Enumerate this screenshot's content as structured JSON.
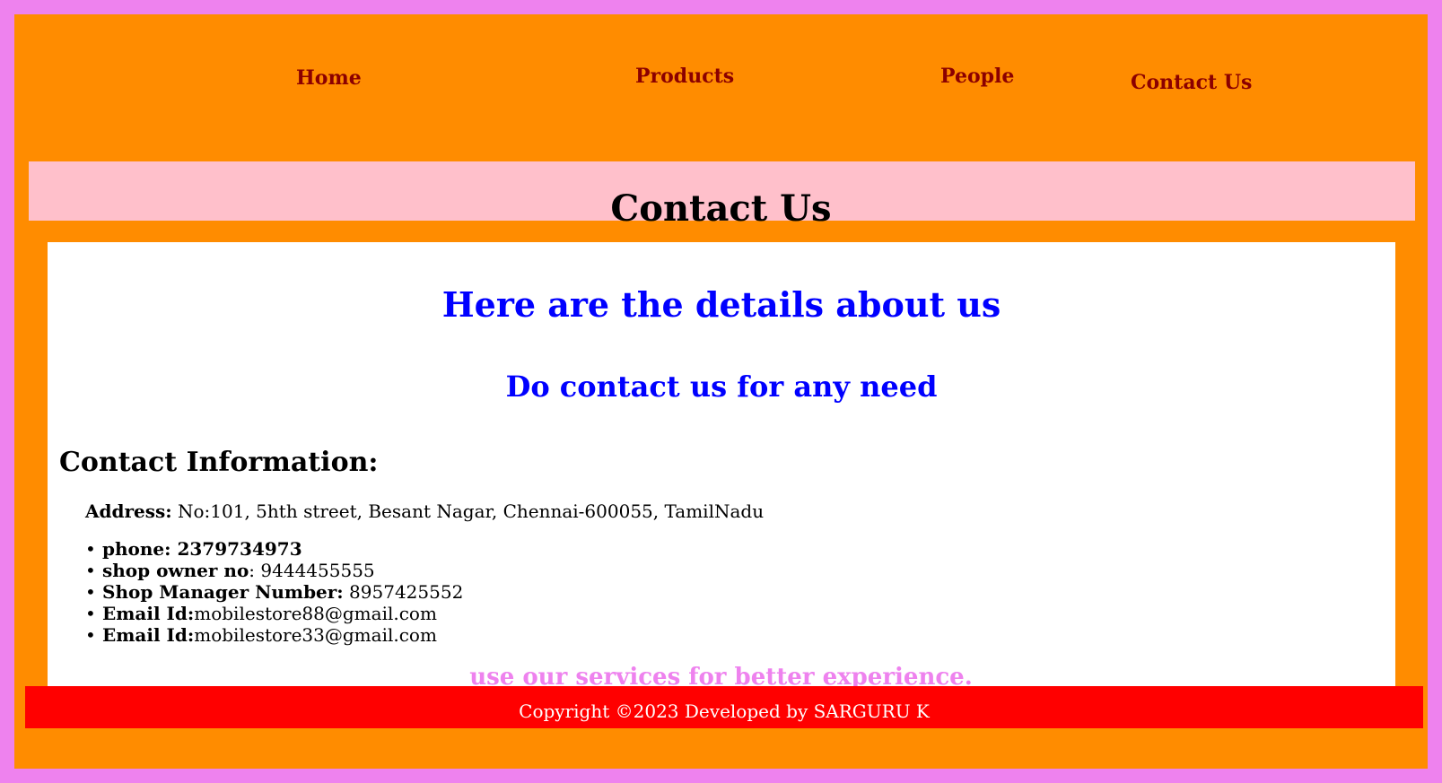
{
  "nav": {
    "home": "Home",
    "products": "Products",
    "people": "People",
    "contact": "Contact Us"
  },
  "banner": {
    "title": "Contact Us"
  },
  "main": {
    "heading": "Here are the details about us",
    "subheading": "Do contact us for any need",
    "info_title": "Contact Information:",
    "address": {
      "label": "Address:",
      "value": " No:101, 5hth street, Besant Nagar, Chennai-600055, TamilNadu"
    },
    "contacts": {
      "phone": {
        "label": "phone: 2379734973"
      },
      "owner": {
        "label": "shop owner no",
        "value": ": 9444455555"
      },
      "manager": {
        "label": "Shop Manager Number:",
        "value": " 8957425552"
      },
      "email1": {
        "label": "Email Id:",
        "value": "mobilestore88@gmail.com"
      },
      "email2": {
        "label": "Email Id:",
        "value": "mobilestore33@gmail.com"
      }
    },
    "tagline": "use our services for better experience."
  },
  "footer": {
    "text": "Copyright ©2023 Developed by SARGURU K"
  },
  "colors": {
    "outer_border": "#ee82ee",
    "page_bg": "#ff8c00",
    "nav_link": "#8b0000",
    "banner_bg": "#ffc0cb",
    "heading_blue": "#0000ff",
    "tagline": "#ee82ee",
    "footer_bg": "#ff0000"
  }
}
